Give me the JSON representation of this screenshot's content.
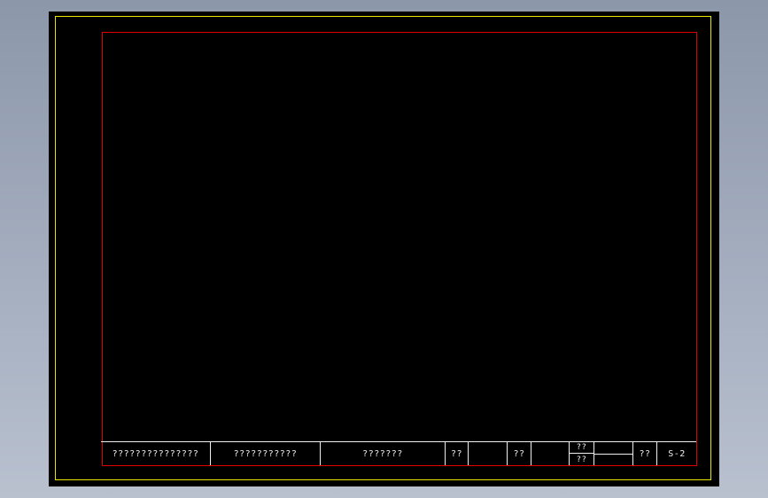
{
  "title_block": {
    "drawing_name": "???????????????",
    "project_name": "???????????",
    "company": "???????",
    "label_1": "??",
    "value_1": "",
    "label_2": "??",
    "value_2": "",
    "split_top": "??",
    "split_bottom": "??",
    "split_value_top": "",
    "split_value_bottom": "",
    "label_3": "??",
    "sheet_number": "S-2"
  },
  "colors": {
    "outer_frame": "#e6e600",
    "inner_frame": "#e00000",
    "text": "#f0f0f0",
    "canvas": "#000000"
  }
}
